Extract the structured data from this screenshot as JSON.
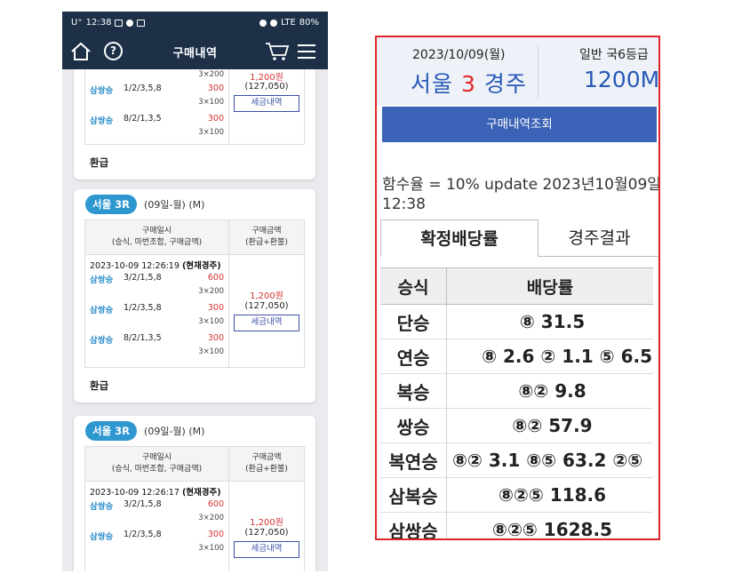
{
  "status_bar": {
    "carrier": "U⁺",
    "time": "12:38",
    "signal": "LTE",
    "battery": "80%"
  },
  "app_bar": {
    "title": "구매내역"
  },
  "top_partial_card": {
    "bets": [
      {
        "type": "삼쌍승",
        "combo": "1/2/3,5,8",
        "amount": "300",
        "sub1": "3×100",
        "pre": "3×200"
      },
      {
        "type": "삼쌍승",
        "combo": "8/2/1,3,5",
        "amount": "300",
        "sub1": "3×100"
      }
    ],
    "amount_won": "1,200원",
    "amount_paren": "(127,050)",
    "tax_button": "세금내역",
    "refund_label": "환급"
  },
  "cards": [
    {
      "race": "서울 3R",
      "date": "(09일-월) (M)",
      "header_left": [
        "구매일시",
        "(승식, 마번조합, 구매금액)"
      ],
      "header_right": [
        "구매금액",
        "(환급+환불)"
      ],
      "time": "2023-10-09 12:26:19",
      "time_tag": "(현재경주)",
      "bets": [
        {
          "type": "삼쌍승",
          "combo": "3/2/1,5,8",
          "amount": "600",
          "sub": "3×200"
        },
        {
          "type": "삼쌍승",
          "combo": "1/2/3,5,8",
          "amount": "300",
          "sub": "3×100"
        },
        {
          "type": "삼쌍승",
          "combo": "8/2/1,3,5",
          "amount": "300",
          "sub": "3×100"
        }
      ],
      "amount_won": "1,200원",
      "amount_paren": "(127,050)",
      "tax_button": "세금내역",
      "refund_label": "환급"
    },
    {
      "race": "서울 3R",
      "date": "(09일-월) (M)",
      "header_left": [
        "구매일시",
        "(승식, 마번조합, 구매금액)"
      ],
      "header_right": [
        "구매금액",
        "(환급+환불)"
      ],
      "time": "2023-10-09 12:26:17",
      "time_tag": "(현재경주)",
      "bets": [
        {
          "type": "삼쌍승",
          "combo": "3/2/1,5,8",
          "amount": "600",
          "sub": "3×200"
        },
        {
          "type": "삼쌍승",
          "combo": "1/2/3,5,8",
          "amount": "300",
          "sub": "3×100"
        }
      ],
      "amount_won": "1,200원",
      "amount_paren": "(127,050)",
      "tax_button": "세금내역"
    }
  ],
  "panel": {
    "date": "2023/10/09(월)",
    "grade": "일반 국6등급",
    "track": "서울",
    "race_no": "3",
    "race_word": "경주",
    "distance": "1200M",
    "lookup_button": "구매내역조회",
    "update_line1": "함수율 = 10% update 2023년10월09일",
    "update_line2": "12:38",
    "tabs": [
      "확정배당률",
      "경주결과"
    ],
    "table_header": [
      "승식",
      "배당률"
    ],
    "rows": [
      {
        "kind": "단승",
        "odds": "⑧ 31.5"
      },
      {
        "kind": "연승",
        "odds": "⑧ 2.6 ② 1.1 ⑤ 6.5"
      },
      {
        "kind": "복승",
        "odds": "⑧② 9.8"
      },
      {
        "kind": "쌍승",
        "odds": "⑧② 57.9"
      },
      {
        "kind": "복연승",
        "odds": "⑧② 3.1 ⑧⑤ 63.2 ②⑤"
      },
      {
        "kind": "삼복승",
        "odds": "⑧②⑤ 118.6"
      },
      {
        "kind": "삼쌍승",
        "odds": "⑧②⑤ 1628.5"
      }
    ]
  },
  "colors": {
    "nav": "#1d3048",
    "accent_blue": "#2f97d0",
    "red": "#e0262a",
    "button_blue": "#3a62b6"
  }
}
